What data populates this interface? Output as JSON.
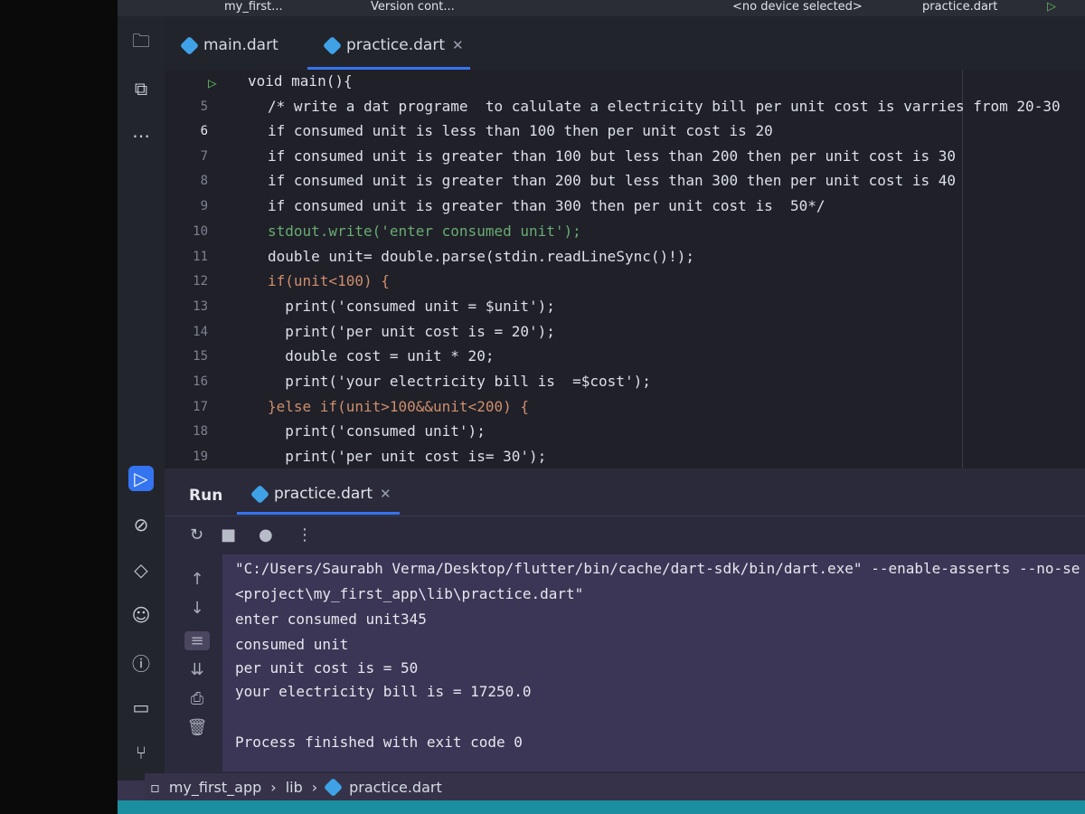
{
  "toolbar": {
    "project": "my_first...",
    "vcs": "Version cont...",
    "device": "<no device selected>",
    "run_config": "practice.dart"
  },
  "editor": {
    "tabs": [
      {
        "label": "main.dart"
      },
      {
        "label": "practice.dart",
        "active": true
      }
    ],
    "lines": [
      {
        "num": "",
        "text": "void main(){"
      },
      {
        "num": "5",
        "text": "/* write a dat programe  to calulate a electricity bill per unit cost is varries from 20-30"
      },
      {
        "num": "6",
        "text": "if consumed unit is less than 100 then per unit cost is 20"
      },
      {
        "num": "7",
        "text": "if consumed unit is greater than 100 but less than 200 then per unit cost is 30"
      },
      {
        "num": "8",
        "text": "if consumed unit is greater than 200 but less than 300 then per unit cost is 40"
      },
      {
        "num": "9",
        "text": "if consumed unit is greater than 300 then per unit cost is  50*/"
      },
      {
        "num": "10",
        "text": "stdout.write('enter consumed unit');"
      },
      {
        "num": "11",
        "text": "double unit= double.parse(stdin.readLineSync()!);"
      },
      {
        "num": "12",
        "text": "if(unit<100) {"
      },
      {
        "num": "13",
        "text": "  print('consumed unit = $unit');"
      },
      {
        "num": "14",
        "text": "  print('per unit cost is = 20');"
      },
      {
        "num": "15",
        "text": "  double cost = unit * 20;"
      },
      {
        "num": "16",
        "text": "  print('your electricity bill is  =$cost');"
      },
      {
        "num": "17",
        "text": "}else if(unit>100&&unit<200) {"
      },
      {
        "num": "18",
        "text": "  print('consumed unit');"
      },
      {
        "num": "19",
        "text": "  print('per unit cost is= 30');"
      }
    ]
  },
  "run": {
    "label": "Run",
    "tab": "practice.dart",
    "console": [
      "\"C:/Users/Saurabh Verma/Desktop/flutter/bin/cache/dart-sdk/bin/dart.exe\" --enable-asserts --no-se",
      "<project\\my_first_app\\lib\\practice.dart\"",
      "enter consumed unit345",
      "consumed unit",
      "per unit cost is = 50",
      "your electricity bill is = 17250.0",
      "",
      "Process finished with exit code 0"
    ]
  },
  "breadcrumb": [
    "my_first_app",
    "lib",
    "practice.dart"
  ]
}
